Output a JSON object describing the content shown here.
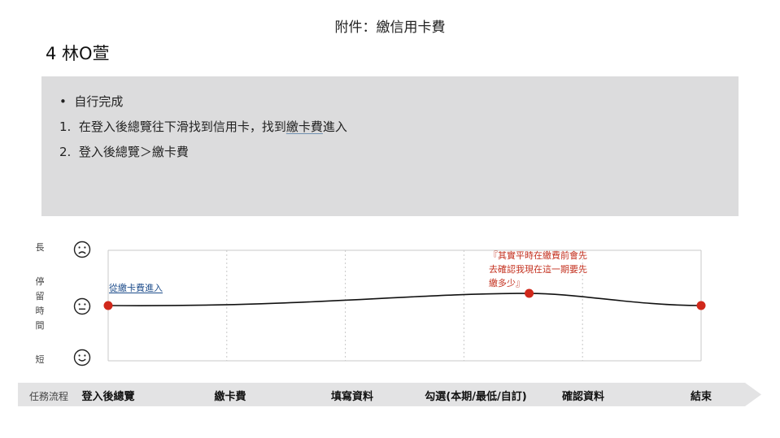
{
  "header": {
    "title": "附件：繳信用卡費",
    "subject": "4 林O萱"
  },
  "notes": {
    "bullet": "•",
    "items": [
      {
        "marker": "",
        "text": "自行完成"
      },
      {
        "marker": "1.",
        "pre": "在登入後總覽往下滑找到信用卡，找到",
        "underlined": "繳卡費",
        "post": "進入"
      },
      {
        "marker": "2.",
        "text": "登入後總覽＞繳卡費"
      }
    ]
  },
  "y_axis": {
    "top_label": "長",
    "middle_label": "停留時間",
    "bottom_label": "短",
    "faces": [
      "sad-face-icon",
      "neutral-face-icon",
      "happy-face-icon"
    ]
  },
  "flow": {
    "label": "任務流程",
    "steps": [
      "登入後總覽",
      "繳卡費",
      "填寫資料",
      "勾選(本期/最低/自訂)",
      "確認資料",
      "結束"
    ]
  },
  "annotations": {
    "start": "從繳卡費進入",
    "note_lines": [
      "『其實平時在繳費前會先",
      "去確認我現在這一期要先",
      "繳多少』"
    ]
  },
  "chart_data": {
    "type": "line",
    "points": [
      {
        "x": 0.0,
        "y": 0.0
      },
      {
        "x": 3.55,
        "y": 0.22
      },
      {
        "x": 5.0,
        "y": 0.0
      }
    ],
    "xlim": [
      0,
      5
    ],
    "ylim": [
      -1,
      1
    ],
    "grid": true,
    "colors": {
      "line": "#111111",
      "marker": "#d0281b",
      "grid": "#c8c8c8"
    }
  }
}
